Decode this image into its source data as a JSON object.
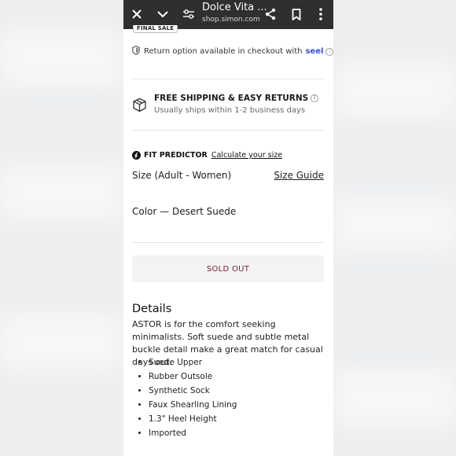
{
  "browser": {
    "title": "Dolce Vita ...",
    "url": "shop.simon.com",
    "icons": [
      "close-icon",
      "chevron-down-icon",
      "site-settings-icon",
      "share-icon",
      "bookmark-icon",
      "more-vert-icon"
    ]
  },
  "product": {
    "final_sale_tag": "FINAL SALE",
    "returns": {
      "text": "Return option available in checkout with",
      "brand": "seel",
      "info_glyph": "i"
    },
    "shipping": {
      "title": "FREE SHIPPING & EASY RETURNS",
      "subtitle": "Usually ships within 1-2 business days",
      "info_glyph": "i"
    },
    "fit_predictor": {
      "label": "FIT PREDICTOR",
      "link": "Calculate your size"
    },
    "size": {
      "label": "Size (Adult - Women)",
      "guide_link": "Size Guide"
    },
    "color": {
      "label": "Color — Desert Suede"
    },
    "button": {
      "label": "SOLD OUT",
      "text_color": "#7a1f33"
    },
    "details": {
      "heading": "Details",
      "description": "ASTOR is for the comfort seeking minimalists. Soft suede and subtle metal buckle detail make a great match for casual days out.",
      "bullets": [
        "Suede Upper",
        "Rubber Outsole",
        "Synthetic Sock",
        "Faux Shearling Lining",
        "1.3\" Heel Height",
        "Imported"
      ]
    }
  }
}
